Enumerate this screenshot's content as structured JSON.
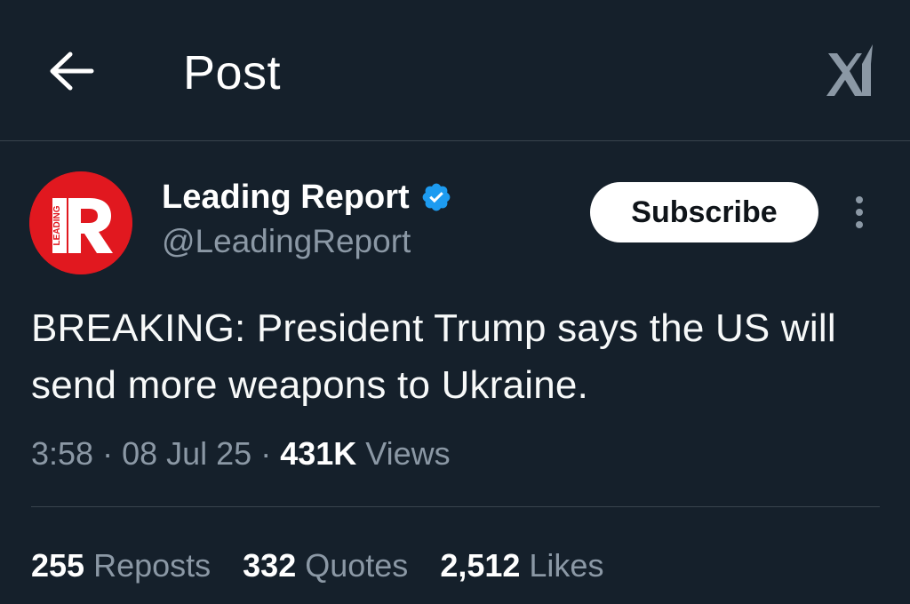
{
  "header": {
    "title": "Post",
    "back_icon": "arrow-left-icon",
    "grok_icon": "grok-icon"
  },
  "author": {
    "avatar_letter": "R",
    "avatar_side_text": "LEADING",
    "display_name": "Leading Report",
    "handle": "@LeadingReport",
    "verified": true,
    "avatar_color": "#e1181f",
    "verified_color": "#1d9bf0"
  },
  "actions": {
    "subscribe_label": "Subscribe",
    "more_icon": "more-vertical-icon"
  },
  "tweet": {
    "text": "BREAKING: President Trump says the US will send more weapons to Ukraine."
  },
  "meta": {
    "time": "3:58",
    "sep1": " · ",
    "date": "08 Jul 25",
    "sep2": " · ",
    "views_count": "431K",
    "views_label": " Views"
  },
  "stats": {
    "reposts_count": "255",
    "reposts_label": " Reposts",
    "quotes_count": "332",
    "quotes_label": " Quotes",
    "likes_count": "2,512",
    "likes_label": " Likes"
  },
  "colors": {
    "background": "#15202b",
    "secondary_text": "#8b98a5",
    "divider": "#38444d"
  }
}
